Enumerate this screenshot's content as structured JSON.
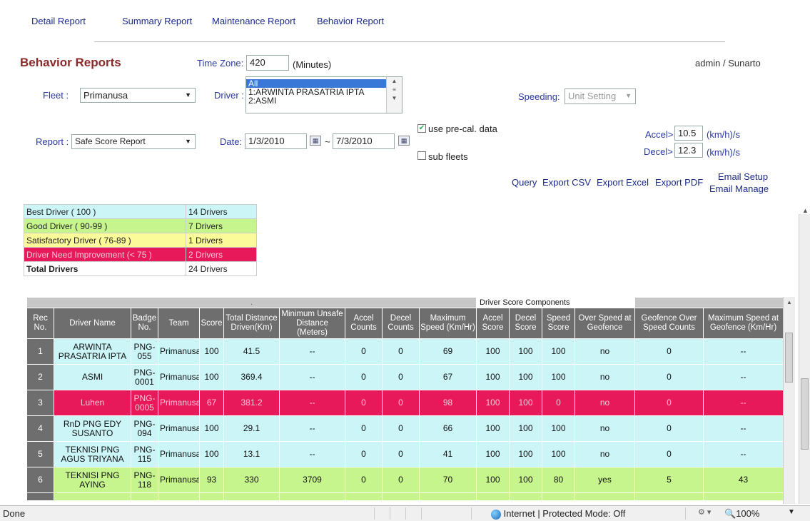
{
  "nav": [
    "Detail Report",
    "Summary Report",
    "Maintenance Report",
    "Behavior Report"
  ],
  "title": "Behavior Reports",
  "user": "admin / Sunarto",
  "timezone": {
    "label": "Time Zone:",
    "value": "420",
    "unit": "(Minutes)"
  },
  "fleet": {
    "label": "Fleet :",
    "value": "Primanusa"
  },
  "driver": {
    "label": "Driver :",
    "options": [
      "All",
      "1:ARWINTA PRASATRIA IPTA",
      "2:ASMI"
    ],
    "selected": "All"
  },
  "speeding": {
    "label": "Speeding:",
    "value": "Unit Setting"
  },
  "report": {
    "label": "Report :",
    "value": "Safe Score Report"
  },
  "date": {
    "label": "Date:",
    "from": "1/3/2010",
    "sep": "~",
    "to": "7/3/2010"
  },
  "options": {
    "precal": "use pre-cal. data",
    "precal_checked": true,
    "subfleets": "sub fleets",
    "subfleets_checked": false
  },
  "accel": {
    "label": "Accel>",
    "value": "10.5",
    "unit": "(km/h)/s"
  },
  "decel": {
    "label": "Decel>",
    "value": "12.3",
    "unit": "(km/h)/s"
  },
  "actions": {
    "query": "Query",
    "csv": "Export CSV",
    "excel": "Export Excel",
    "pdf": "Export PDF",
    "email_setup": "Email Setup",
    "email_manage": "Email Manage"
  },
  "legend": [
    {
      "label": "Best Driver ( 100 )",
      "count": "14 Drivers",
      "color": "#ccf5f8"
    },
    {
      "label": "Good Driver ( 90-99 )",
      "count": "7 Drivers",
      "color": "#c7f58d"
    },
    {
      "label": "Satisfactory Driver ( 76-89 )",
      "count": "1 Drivers",
      "color": "#fbfb9a"
    },
    {
      "label": "Driver Need Improvement (< 75 )",
      "count": "2 Drivers",
      "color": "#e8195a"
    },
    {
      "label": "Total Drivers",
      "count": "24 Drivers",
      "color": "#ffffff"
    }
  ],
  "grid": {
    "band_label": "Driver Score Components",
    "band_dot": ".",
    "headers": [
      "Rec No.",
      "Driver Name",
      "Badge No.",
      "Team",
      "Score",
      "Total Distance Driven(Km)",
      "Minimum Unsafe Distance (Meters)",
      "Accel Counts",
      "Decel Counts",
      "Maximum Speed (Km/Hr)",
      "Accel Score",
      "Decel Score",
      "Speed Score",
      "Over Speed at Geofence",
      "Geofence Over Speed Counts",
      "Maximum Speed at Geofence (Km/Hr)"
    ],
    "rows": [
      [
        "1",
        "ARWINTA PRASATRIA IPTA",
        "PNG-055",
        "Primanusa",
        "100",
        "41.5",
        "--",
        "0",
        "0",
        "69",
        "100",
        "100",
        "100",
        "no",
        "0",
        "--"
      ],
      [
        "2",
        "ASMI",
        "PNG-0001",
        "Primanusa",
        "100",
        "369.4",
        "--",
        "0",
        "0",
        "67",
        "100",
        "100",
        "100",
        "no",
        "0",
        "--"
      ],
      [
        "3",
        "Luhen",
        "PNG-0005",
        "Primanusa",
        "67",
        "381.2",
        "--",
        "0",
        "0",
        "98",
        "100",
        "100",
        "0",
        "no",
        "0",
        "--"
      ],
      [
        "4",
        "RnD PNG EDY SUSANTO",
        "PNG-094",
        "Primanusa",
        "100",
        "29.1",
        "--",
        "0",
        "0",
        "66",
        "100",
        "100",
        "100",
        "no",
        "0",
        "--"
      ],
      [
        "5",
        "TEKNISI PNG AGUS TRIYANA",
        "PNG-115",
        "Primanusa",
        "100",
        "13.1",
        "--",
        "0",
        "0",
        "41",
        "100",
        "100",
        "100",
        "no",
        "0",
        "--"
      ],
      [
        "6",
        "TEKNISI PNG AYING",
        "PNG-118",
        "Primanusa",
        "93",
        "330",
        "3709",
        "0",
        "0",
        "70",
        "100",
        "100",
        "80",
        "yes",
        "5",
        "43"
      ]
    ],
    "row_classes": [
      "blue",
      "blue",
      "red",
      "blue",
      "blue",
      "green"
    ]
  },
  "status": {
    "left": "Done",
    "zone": "Internet | Protected Mode: Off",
    "zoom": "100%"
  }
}
